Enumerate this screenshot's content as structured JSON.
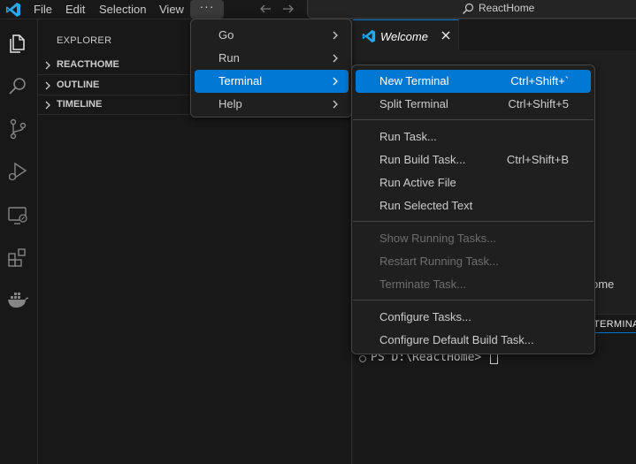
{
  "titlebar": {
    "menus": [
      "File",
      "Edit",
      "Selection",
      "View"
    ],
    "more_label": "···",
    "search_label": "ReactHome"
  },
  "activity_bar": {
    "icons": [
      "explorer-icon",
      "search-icon",
      "source-control-icon",
      "run-debug-icon",
      "remote-explorer-icon",
      "extensions-icon",
      "docker-icon"
    ]
  },
  "sidebar": {
    "title": "EXPLORER",
    "sections": [
      "REACTHOME",
      "OUTLINE",
      "TIMELINE"
    ]
  },
  "editor": {
    "tab_label": "Welcome",
    "welcome_text_fragment": "ome"
  },
  "panel": {
    "tab_label": "TERMINAL",
    "prompt": "PS D:\\ReactHome>"
  },
  "main_menu": {
    "items": [
      {
        "label": "Go",
        "submenu": true,
        "active": false
      },
      {
        "label": "Run",
        "submenu": true,
        "active": false
      },
      {
        "label": "Terminal",
        "submenu": true,
        "active": true
      },
      {
        "label": "Help",
        "submenu": true,
        "active": false
      }
    ]
  },
  "terminal_menu": {
    "items": [
      {
        "label": "New Terminal",
        "shortcut": "Ctrl+Shift+`",
        "active": true,
        "disabled": false
      },
      {
        "label": "Split Terminal",
        "shortcut": "Ctrl+Shift+5",
        "active": false,
        "disabled": false
      },
      {
        "label": "Run Task...",
        "shortcut": "",
        "active": false,
        "disabled": false
      },
      {
        "label": "Run Build Task...",
        "shortcut": "Ctrl+Shift+B",
        "active": false,
        "disabled": false
      },
      {
        "label": "Run Active File",
        "shortcut": "",
        "active": false,
        "disabled": false
      },
      {
        "label": "Run Selected Text",
        "shortcut": "",
        "active": false,
        "disabled": false
      },
      {
        "label": "Show Running Tasks...",
        "shortcut": "",
        "active": false,
        "disabled": true
      },
      {
        "label": "Restart Running Task...",
        "shortcut": "",
        "active": false,
        "disabled": true
      },
      {
        "label": "Terminate Task...",
        "shortcut": "",
        "active": false,
        "disabled": true
      },
      {
        "label": "Configure Tasks...",
        "shortcut": "",
        "active": false,
        "disabled": false
      },
      {
        "label": "Configure Default Build Task...",
        "shortcut": "",
        "active": false,
        "disabled": false
      }
    ]
  },
  "colors": {
    "accent": "#0078d4",
    "vscode_blue": "#23a9f2",
    "background": "#1f1f1f",
    "chrome": "#181818"
  }
}
